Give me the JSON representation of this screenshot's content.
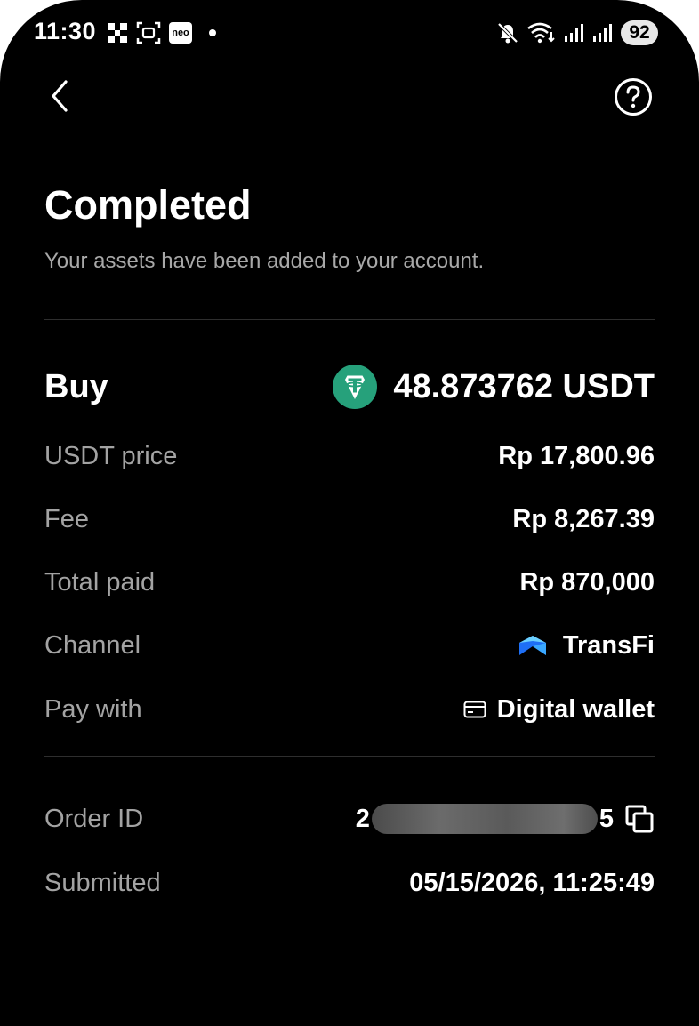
{
  "status_bar": {
    "time": "11:30",
    "neo_label": "neo",
    "battery": "92",
    "icons": [
      "scan-icon",
      "screenshot-icon",
      "neo-app-icon",
      "notification-dot-icon",
      "mute-icon",
      "wifi-icon",
      "signal-icon",
      "signal-icon",
      "battery-icon"
    ]
  },
  "nav": {
    "back_icon": "chevron-left-icon",
    "help_icon": "help-circle-icon"
  },
  "header": {
    "title": "Completed",
    "subtitle": "Your assets have been added to your account."
  },
  "summary": {
    "buy_label": "Buy",
    "buy_amount": "48.873762 USDT",
    "buy_icon": "usdt-icon",
    "usdt_color": "#26a17b"
  },
  "details": {
    "usdt_price_label": "USDT price",
    "usdt_price_value": "Rp 17,800.96",
    "fee_label": "Fee",
    "fee_value": "Rp 8,267.39",
    "total_label": "Total paid",
    "total_value": "Rp 870,000",
    "channel_label": "Channel",
    "channel_value": "TransFi",
    "channel_icon": "transfi-logo-icon",
    "pay_label": "Pay with",
    "pay_value": "Digital wallet",
    "pay_icon": "card-icon"
  },
  "order": {
    "order_id_label": "Order ID",
    "order_id_prefix": "2",
    "order_id_suffix": "5",
    "copy_icon": "copy-icon",
    "submitted_label": "Submitted",
    "submitted_value": "05/15/2026, 11:25:49"
  }
}
